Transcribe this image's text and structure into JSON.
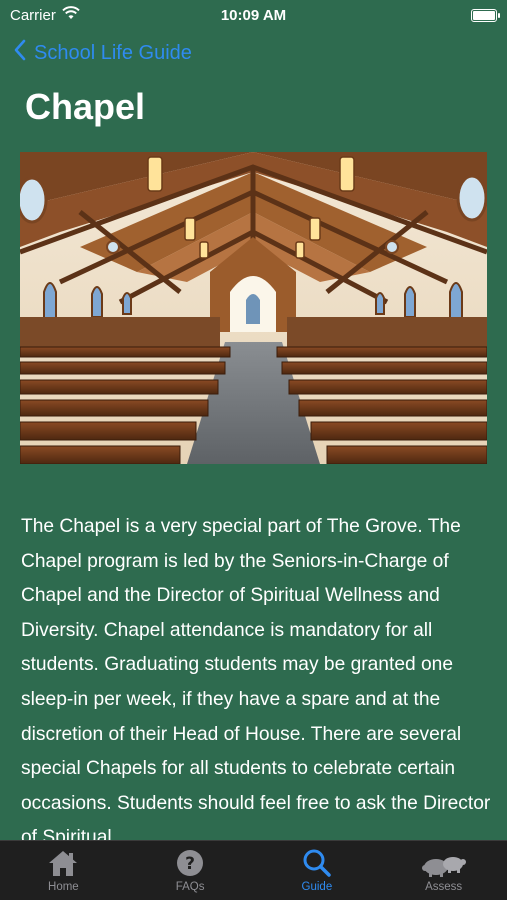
{
  "status_bar": {
    "carrier": "Carrier",
    "time": "10:09 AM"
  },
  "nav": {
    "back_label": "School Life Guide"
  },
  "page": {
    "title": "Chapel"
  },
  "hero_image": {
    "icon": "chapel-interior-photo"
  },
  "content": {
    "paragraph": "The Chapel is a very special part of The Grove. The Chapel program is led by the Seniors-in-Charge of Chapel and the Director of Spiritual Wellness and Diversity. Chapel attendance is mandatory for all students. Graduating students may be granted one sleep-in per week, if they have a spare and at the discretion of their Head of House. There are several special Chapels for all students to celebrate certain occasions. Students should feel free to ask the Director of Spiritual"
  },
  "tabs": [
    {
      "label": "Home",
      "icon": "home-icon"
    },
    {
      "label": "FAQs",
      "icon": "question-icon"
    },
    {
      "label": "Guide",
      "icon": "search-icon",
      "active": true
    },
    {
      "label": "Assess",
      "icon": "turtles-icon"
    }
  ],
  "colors": {
    "background": "#2e6b4f",
    "accent": "#2f8bf0",
    "tab_bar": "#1f1f1f"
  }
}
